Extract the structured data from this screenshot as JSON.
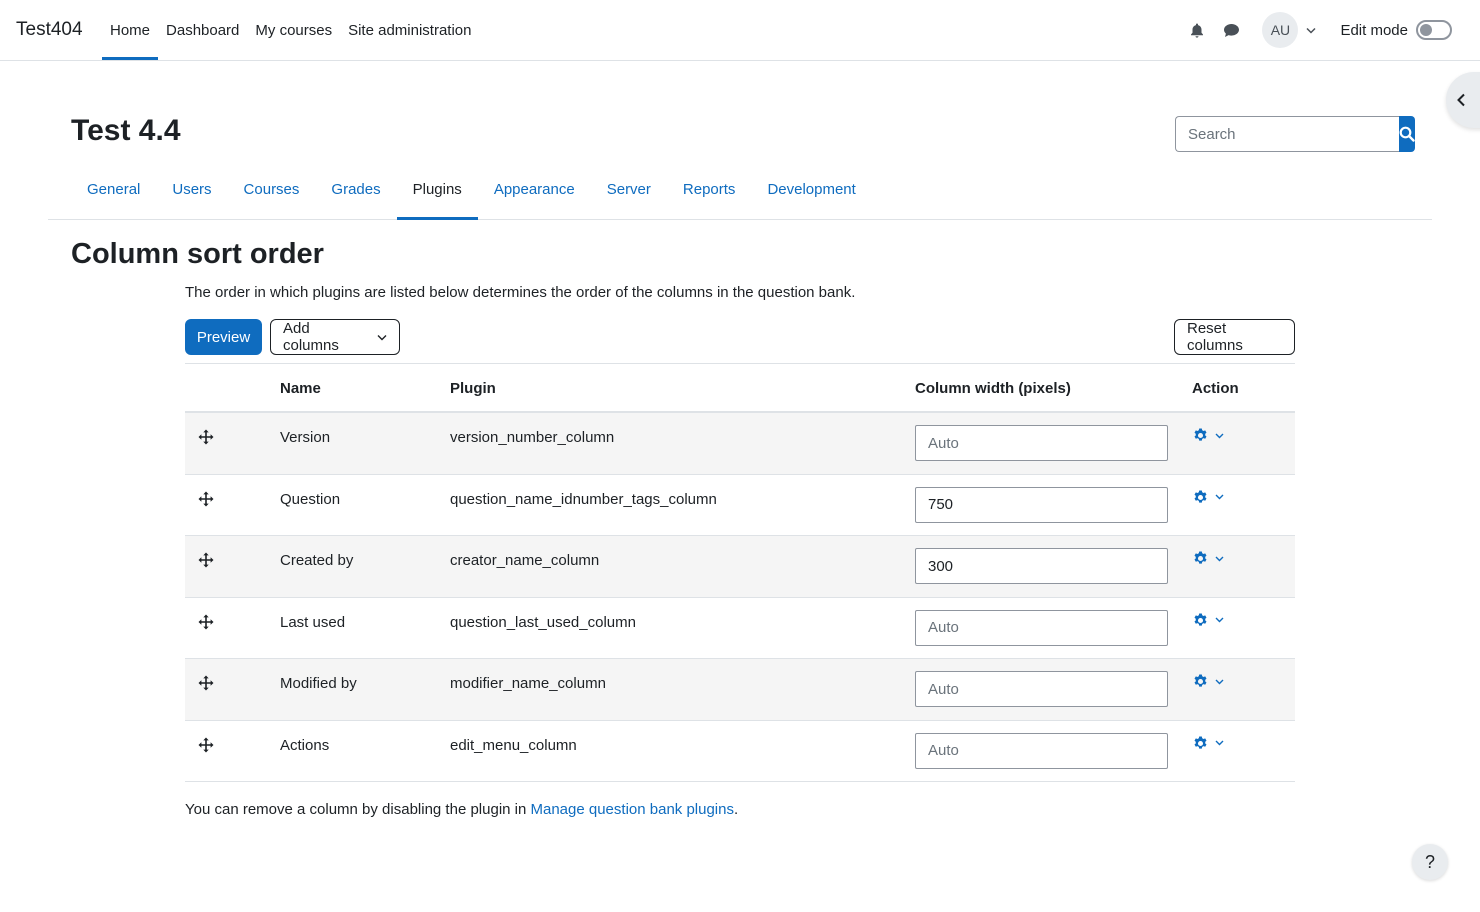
{
  "navbar": {
    "brand": "Test404",
    "items": [
      {
        "label": "Home",
        "active": true
      },
      {
        "label": "Dashboard",
        "active": false
      },
      {
        "label": "My courses",
        "active": false
      },
      {
        "label": "Site administration",
        "active": false
      }
    ],
    "avatar_initials": "AU",
    "edit_mode_label": "Edit mode",
    "edit_mode_on": false
  },
  "header": {
    "title": "Test 4.4",
    "search_placeholder": "Search"
  },
  "secondary_nav": [
    {
      "label": "General",
      "active": false
    },
    {
      "label": "Users",
      "active": false
    },
    {
      "label": "Courses",
      "active": false
    },
    {
      "label": "Grades",
      "active": false
    },
    {
      "label": "Plugins",
      "active": true
    },
    {
      "label": "Appearance",
      "active": false
    },
    {
      "label": "Server",
      "active": false
    },
    {
      "label": "Reports",
      "active": false
    },
    {
      "label": "Development",
      "active": false
    }
  ],
  "main": {
    "title": "Column sort order",
    "description": "The order in which plugins are listed below determines the order of the columns in the question bank.",
    "preview_label": "Preview",
    "add_columns_label": "Add columns",
    "reset_columns_label": "Reset columns",
    "table": {
      "headers": {
        "name": "Name",
        "plugin": "Plugin",
        "width": "Column width (pixels)",
        "action": "Action"
      },
      "rows": [
        {
          "name": "Version",
          "plugin": "version_number_column",
          "width": "",
          "placeholder": "Auto"
        },
        {
          "name": "Question",
          "plugin": "question_name_idnumber_tags_column",
          "width": "750",
          "placeholder": "Auto"
        },
        {
          "name": "Created by",
          "plugin": "creator_name_column",
          "width": "300",
          "placeholder": "Auto"
        },
        {
          "name": "Last used",
          "plugin": "question_last_used_column",
          "width": "",
          "placeholder": "Auto"
        },
        {
          "name": "Modified by",
          "plugin": "modifier_name_column",
          "width": "",
          "placeholder": "Auto"
        },
        {
          "name": "Actions",
          "plugin": "edit_menu_column",
          "width": "",
          "placeholder": "Auto"
        }
      ]
    },
    "footer_prefix": "You can remove a column by disabling the plugin in ",
    "footer_link": "Manage question bank plugins",
    "footer_suffix": "."
  },
  "help_label": "?",
  "colors": {
    "primary": "#0f6cbf",
    "text": "#1d2125",
    "border": "#dee2e6"
  }
}
